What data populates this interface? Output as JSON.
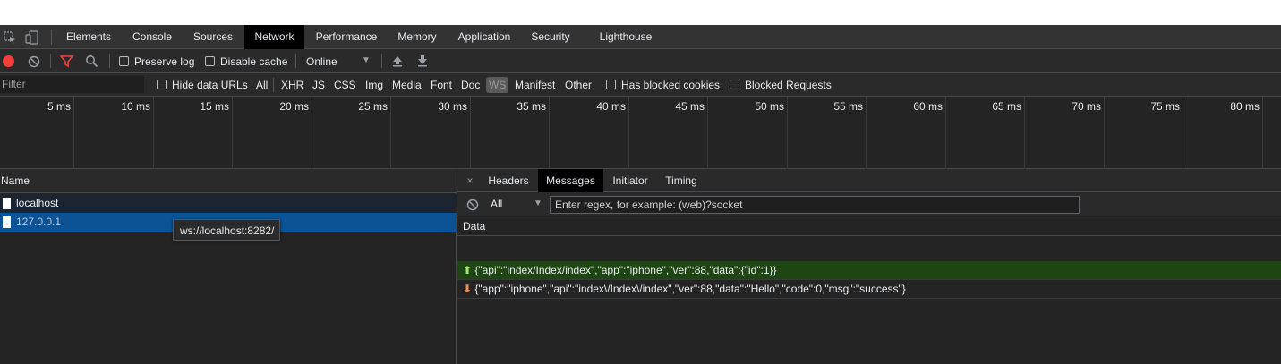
{
  "tabs": [
    {
      "label": "Elements"
    },
    {
      "label": "Console"
    },
    {
      "label": "Sources"
    },
    {
      "label": "Network",
      "active": true
    },
    {
      "label": "Performance"
    },
    {
      "label": "Memory"
    },
    {
      "label": "Application"
    },
    {
      "label": "Security"
    },
    {
      "label": "Lighthouse"
    }
  ],
  "toolbar": {
    "preserve_log": "Preserve log",
    "disable_cache": "Disable cache",
    "throttling": "Online"
  },
  "filterbar": {
    "filter_placeholder": "Filter",
    "hide_data_urls": "Hide data URLs",
    "types": [
      "All",
      "XHR",
      "JS",
      "CSS",
      "Img",
      "Media",
      "Font",
      "Doc",
      "WS",
      "Manifest",
      "Other"
    ],
    "active_type": "WS",
    "has_blocked_cookies": "Has blocked cookies",
    "blocked_requests": "Blocked Requests"
  },
  "overview": {
    "ticks": [
      "5 ms",
      "10 ms",
      "15 ms",
      "20 ms",
      "25 ms",
      "30 ms",
      "35 ms",
      "40 ms",
      "45 ms",
      "50 ms",
      "55 ms",
      "60 ms",
      "65 ms",
      "70 ms",
      "75 ms",
      "80 ms"
    ]
  },
  "requests": {
    "header": "Name",
    "rows": [
      {
        "name": "localhost"
      },
      {
        "name": "127.0.0.1",
        "selected": true
      }
    ],
    "tooltip": "ws://localhost:8282/"
  },
  "details": {
    "close_glyph": "×",
    "tabs": [
      "Headers",
      "Messages",
      "Initiator",
      "Timing"
    ],
    "active_tab": "Messages",
    "filter_select": "All",
    "regex_placeholder": "Enter regex, for example: (web)?socket",
    "data_header": "Data",
    "messages": [
      {
        "direction": "sent",
        "text": "{\"api\":\"index/Index/index\",\"app\":\"iphone\",\"ver\":88,\"data\":{\"id\":1}}"
      },
      {
        "direction": "received",
        "text": "{\"app\":\"iphone\",\"api\":\"index\\/Index\\/index\",\"ver\":88,\"data\":\"Hello\",\"code\":0,\"msg\":\"success\"}"
      }
    ]
  },
  "colors": {
    "record": "#f2413a",
    "filter_active": "#f2413a",
    "selected_row": "#0b5394",
    "sent_row": "#1e4612",
    "sent_arrow": "#9ee86f",
    "recv_arrow": "#f28b54"
  }
}
